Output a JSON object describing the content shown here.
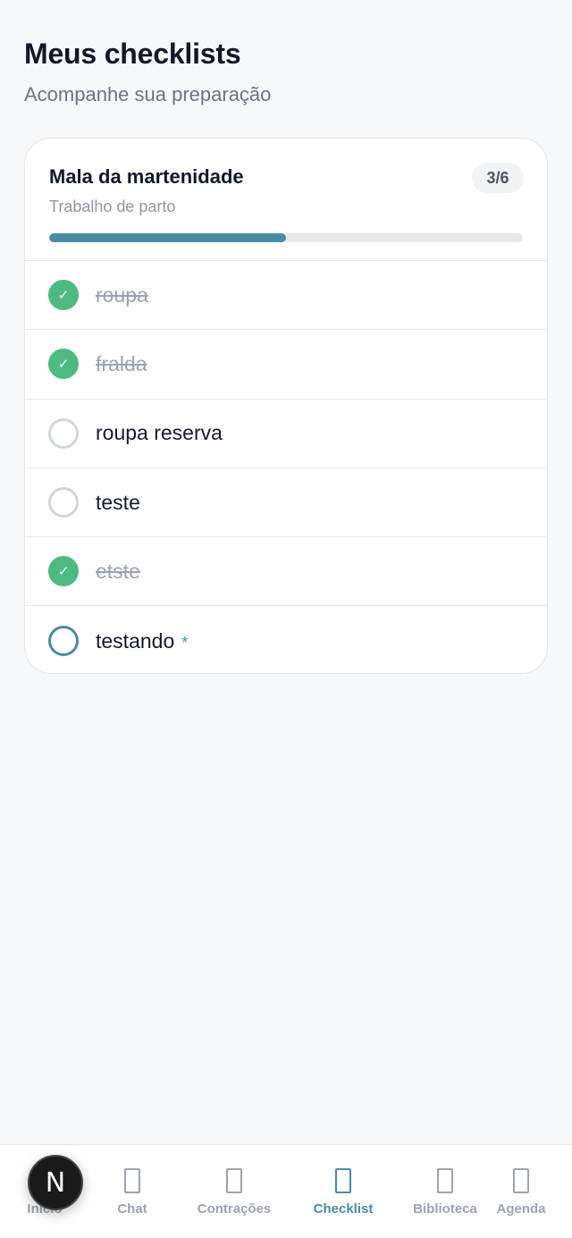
{
  "header": {
    "title": "Meus checklists",
    "subtitle": "Acompanhe sua preparação"
  },
  "checklist": {
    "title": "Mala da martenidade",
    "subtitle": "Trabalho de parto",
    "count": "3/6",
    "progress": 0.5,
    "items": [
      {
        "label": "roupa",
        "done": true
      },
      {
        "label": "fralda",
        "done": true
      },
      {
        "label": "roupa reserva",
        "done": false
      },
      {
        "label": "teste",
        "done": false
      },
      {
        "label": "etste",
        "done": true
      },
      {
        "label": "testando",
        "done": false,
        "required_mark": "*"
      }
    ]
  },
  "nav": {
    "items": [
      {
        "label": "Início",
        "icon": "home-icon"
      },
      {
        "label": "Chat",
        "icon": "chat-icon"
      },
      {
        "label": "Contrações",
        "icon": "timer-icon"
      },
      {
        "label": "Checklist",
        "icon": "checklist-icon",
        "active": true
      },
      {
        "label": "Biblioteca",
        "icon": "book-icon"
      },
      {
        "label": "Agenda",
        "icon": "calendar-icon"
      }
    ]
  },
  "fab": {
    "letter": "N"
  },
  "colors": {
    "accent": "#4a8aa3",
    "done": "#4eba82",
    "background": "#f7f8fa"
  }
}
